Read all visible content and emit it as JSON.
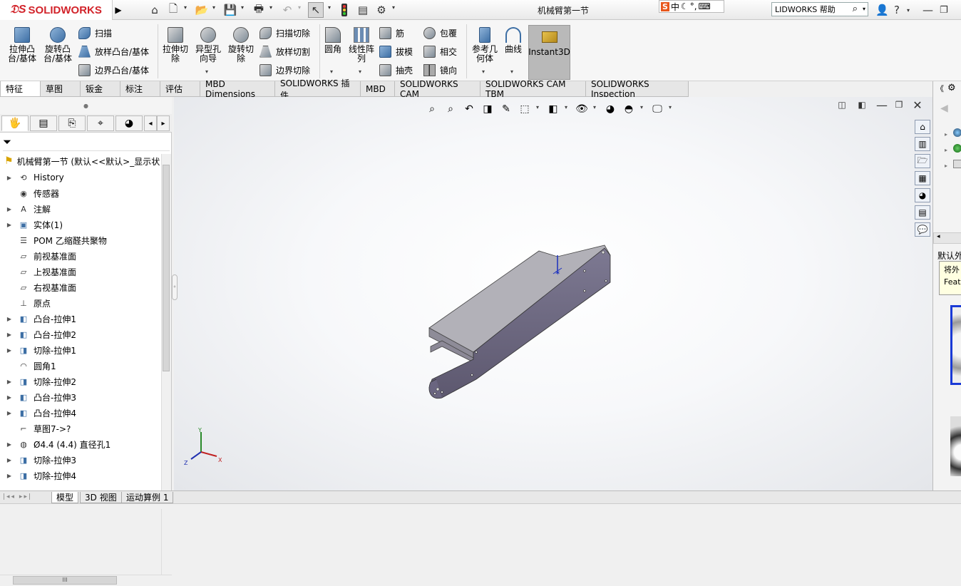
{
  "app": {
    "brand": "SOLIDWORKS",
    "document_title": "机械臂第一节"
  },
  "titlebar": {
    "ime": {
      "badge": "S",
      "lang": "中"
    },
    "help_search_placeholder": "LIDWORKS 帮助"
  },
  "command_manager": {
    "big_buttons": [
      {
        "label": "拉伸凸\n台/基体"
      },
      {
        "label": "旋转凸\n台/基体"
      },
      {
        "label": "拉伸切\n除"
      },
      {
        "label": "异型孔\n向导"
      },
      {
        "label": "旋转切\n除"
      },
      {
        "label": "圆角"
      },
      {
        "label": "线性阵\n列"
      },
      {
        "label": "参考几\n何体"
      },
      {
        "label": "曲线"
      }
    ],
    "small_buttons": [
      {
        "label": "扫描"
      },
      {
        "label": "放样凸台/基体"
      },
      {
        "label": "边界凸台/基体"
      },
      {
        "label": "扫描切除"
      },
      {
        "label": "放样切割"
      },
      {
        "label": "边界切除"
      },
      {
        "label": "筋"
      },
      {
        "label": "拔模"
      },
      {
        "label": "抽壳"
      },
      {
        "label": "包覆"
      },
      {
        "label": "相交"
      },
      {
        "label": "镜向"
      }
    ],
    "instant3d": "Instant3D"
  },
  "tabs": [
    {
      "label": "特征",
      "active": true
    },
    {
      "label": "草图"
    },
    {
      "label": "钣金"
    },
    {
      "label": "标注"
    },
    {
      "label": "评估"
    },
    {
      "label": "MBD Dimensions"
    },
    {
      "label": "SOLIDWORKS 插件"
    },
    {
      "label": "MBD"
    },
    {
      "label": "SOLIDWORKS CAM"
    },
    {
      "label": "SOLIDWORKS CAM TBM"
    },
    {
      "label": "SOLIDWORKS Inspection"
    }
  ],
  "feature_tree": {
    "root": "机械臂第一节  (默认<<默认>_显示状",
    "items": [
      {
        "label": "History",
        "expandable": true,
        "icon": "history-icon"
      },
      {
        "label": "传感器",
        "expandable": false,
        "icon": "sensor-icon"
      },
      {
        "label": "注解",
        "expandable": true,
        "icon": "annotation-icon"
      },
      {
        "label": "实体(1)",
        "expandable": true,
        "icon": "solid-body-icon"
      },
      {
        "label": "POM 乙缩醛共聚物",
        "expandable": false,
        "icon": "material-icon"
      },
      {
        "label": "前视基准面",
        "expandable": false,
        "icon": "plane-icon"
      },
      {
        "label": "上视基准面",
        "expandable": false,
        "icon": "plane-icon"
      },
      {
        "label": "右视基准面",
        "expandable": false,
        "icon": "plane-icon"
      },
      {
        "label": "原点",
        "expandable": false,
        "icon": "origin-icon"
      },
      {
        "label": "凸台-拉伸1",
        "expandable": true,
        "icon": "extrude-icon"
      },
      {
        "label": "凸台-拉伸2",
        "expandable": true,
        "icon": "extrude-icon"
      },
      {
        "label": "切除-拉伸1",
        "expandable": true,
        "icon": "cut-icon"
      },
      {
        "label": "圆角1",
        "expandable": false,
        "icon": "fillet-icon"
      },
      {
        "label": "切除-拉伸2",
        "expandable": true,
        "icon": "cut-icon"
      },
      {
        "label": "凸台-拉伸3",
        "expandable": true,
        "icon": "extrude-icon"
      },
      {
        "label": "凸台-拉伸4",
        "expandable": true,
        "icon": "extrude-icon"
      },
      {
        "label": "草图7->?",
        "expandable": false,
        "icon": "sketch-icon"
      },
      {
        "label": "Ø4.4 (4.4) 直径孔1",
        "expandable": true,
        "icon": "hole-icon"
      },
      {
        "label": "切除-拉伸3",
        "expandable": true,
        "icon": "cut-icon"
      },
      {
        "label": "切除-拉伸4",
        "expandable": true,
        "icon": "cut-icon"
      }
    ]
  },
  "viewport": {
    "triad": {
      "x": "X",
      "y": "Y",
      "z": "Z"
    }
  },
  "taskpane": {
    "text1": "默认外",
    "tooltip_line1": "将外",
    "tooltip_line2": "Featu"
  },
  "bottom_tabs": [
    {
      "label": "模型",
      "active": true
    },
    {
      "label": "3D 视图"
    },
    {
      "label": "运动算例 1"
    }
  ]
}
